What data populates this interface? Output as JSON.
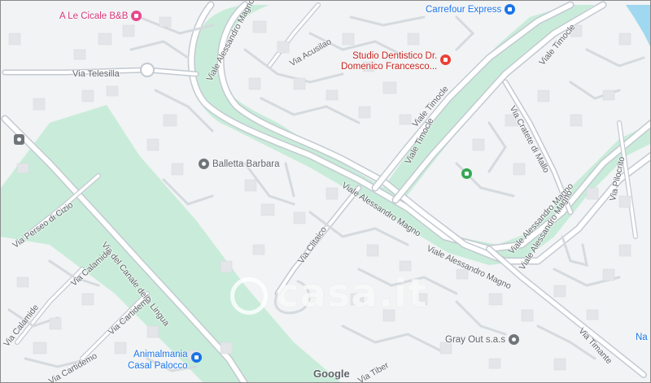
{
  "map": {
    "colors": {
      "background": "#f1f3f4",
      "park": "#c8ecd9",
      "road": "#ffffff",
      "road_outline": "#c3c9d1",
      "water": "#9fd8f0"
    },
    "pois": {
      "cicale": "A Le Cicale B&B",
      "carrefour": "Carrefour Express",
      "dentist_line1": "Studio Dentistico Dr.",
      "dentist_line2": "Domenico Francesco...",
      "balletta": "Balletta Barbara",
      "animalmania_line1": "Animalmania",
      "animalmania_line2": "Casal Palocco",
      "grayout": "Gray Out s.a.s",
      "partial_right": "Na"
    },
    "streets": {
      "telesilla": "Via Telesilla",
      "alessandro_top": "Viale Alessandro Magno",
      "acusilao": "Via Acusilao",
      "timocle_a": "Viale Timocle",
      "timocle_b": "Viale Timocle",
      "timocle_top": "Viale Timocle",
      "cratete": "Via Cratete di Mallo",
      "alessandro_mid": "Viale Alessandro Magno",
      "alessandro_low": "Viale Alessandro Magno",
      "alessandro_right1": "Viale Alessandro Magno",
      "alessandro_right2": "Viale Alessandro Magno",
      "pilocrito": "Via Pilocrito",
      "perseo": "Via Perseo di Cizio",
      "canale": "Via del Canale della Lingua",
      "calamide_a": "Via Calamide",
      "calamide_b": "Via Calamide",
      "cartidemo": "Via Cartidemo",
      "cartidemo_b": "Via Cartidemo",
      "clitaico": "Via Clitaico",
      "timante": "Via Timante",
      "tiberi_partial": "Via Tiber"
    },
    "icons": [
      "bed-icon",
      "shopping-cart-icon",
      "medical-icon",
      "pin-icon",
      "tree-icon",
      "pet-shop-icon",
      "bus-stop-icon"
    ],
    "watermark": "casa.it",
    "attribution": "Google"
  }
}
